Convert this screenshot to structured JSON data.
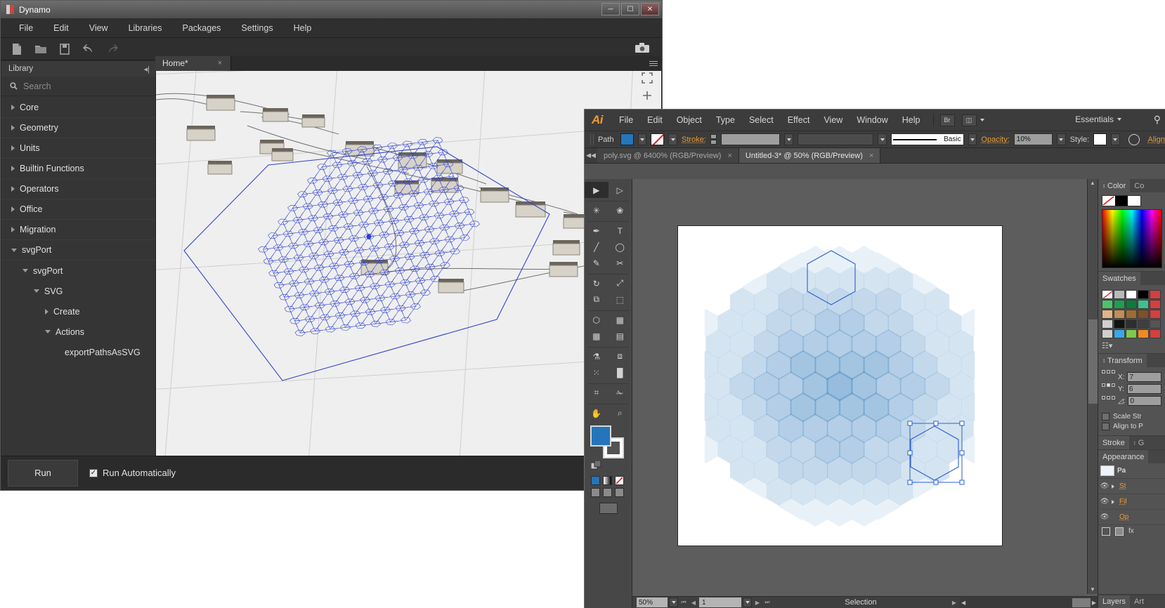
{
  "dynamo": {
    "title": "Dynamo",
    "window_buttons": [
      "minimize",
      "maximize",
      "close"
    ],
    "menus": [
      "File",
      "Edit",
      "View",
      "Libraries",
      "Packages",
      "Settings",
      "Help"
    ],
    "toolbar_icons": [
      "new-file-icon",
      "open-file-icon",
      "save-icon",
      "undo-icon",
      "redo-icon",
      "camera-icon"
    ],
    "library": {
      "header": "Library",
      "collapse_icon": "collapse-panel-icon",
      "search_placeholder": "Search",
      "search_icon": "search-icon",
      "items": [
        {
          "label": "Core",
          "expanded": false,
          "indent": 0
        },
        {
          "label": "Geometry",
          "expanded": false,
          "indent": 0
        },
        {
          "label": "Units",
          "expanded": false,
          "indent": 0
        },
        {
          "label": "Builtin Functions",
          "expanded": false,
          "indent": 0
        },
        {
          "label": "Operators",
          "expanded": false,
          "indent": 0
        },
        {
          "label": "Office",
          "expanded": false,
          "indent": 0
        },
        {
          "label": "Migration",
          "expanded": false,
          "indent": 0
        },
        {
          "label": "svgPort",
          "expanded": true,
          "indent": 0
        },
        {
          "label": "svgPort",
          "expanded": true,
          "indent": 1
        },
        {
          "label": "SVG",
          "expanded": true,
          "indent": 2
        },
        {
          "label": "Create",
          "expanded": false,
          "indent": 3
        },
        {
          "label": "Actions",
          "expanded": true,
          "indent": 3
        },
        {
          "label": "exportPathsAsSVG",
          "expanded": null,
          "indent": 4
        }
      ]
    },
    "tab": {
      "label": "Home*",
      "close": "×"
    },
    "menu_icon": "hamburger-menu-icon",
    "viewport_controls": [
      "fit-to-screen-icon",
      "zoom-in-icon"
    ],
    "footer": {
      "run_label": "Run",
      "auto_label": "Run Automatically",
      "auto_checked": true,
      "check_glyph": "✓"
    }
  },
  "illustrator": {
    "logo": "Ai",
    "menus": [
      "File",
      "Edit",
      "Object",
      "Type",
      "Select",
      "Effect",
      "View",
      "Window",
      "Help"
    ],
    "bridge_button": "Br",
    "arrange_button": "arrange-documents-icon",
    "workspace": "Essentials",
    "search_icon": "search-icon",
    "control_bar": {
      "object_type": "Path",
      "fill_color": "#2575bb",
      "stroke_color": "none",
      "stroke_label": "Stroke:",
      "stroke_weight": "",
      "stroke_profile": "",
      "brush": "Basic",
      "opacity_label": "Opacity:",
      "opacity_value": "10%",
      "style_label": "Style:",
      "align_label": "Align"
    },
    "tabs": [
      {
        "label": "poly.svg @ 6400% (RGB/Preview)",
        "active": false,
        "close": "×"
      },
      {
        "label": "Untitled-3* @ 50% (RGB/Preview)",
        "active": true,
        "close": "×"
      }
    ],
    "tools": [
      "selection-tool-icon",
      "direct-selection-tool-icon",
      "magic-wand-tool-icon",
      "lasso-tool-icon",
      "pen-tool-icon",
      "type-tool-icon",
      "line-segment-tool-icon",
      "ellipse-tool-icon",
      "paintbrush-tool-icon",
      "scissors-tool-icon",
      "rotate-tool-icon",
      "scale-tool-icon",
      "width-tool-icon",
      "free-transform-tool-icon",
      "shape-builder-tool-icon",
      "perspective-grid-tool-icon",
      "mesh-tool-icon",
      "gradient-tool-icon",
      "eyedropper-tool-icon",
      "blend-tool-icon",
      "symbol-sprayer-tool-icon",
      "column-graph-tool-icon",
      "artboard-tool-icon",
      "slice-tool-icon",
      "hand-tool-icon",
      "zoom-tool-icon"
    ],
    "fill_stroke": {
      "fill": "#2575bb",
      "stroke": "none",
      "swap_icon": "swap-fill-stroke-icon",
      "default_icon": "default-fill-stroke-icon"
    },
    "color_modes": [
      "color-mode-icon",
      "gradient-mode-icon",
      "none-mode-icon"
    ],
    "screen_mode_icon": "change-screen-mode-icon",
    "status_bar": {
      "zoom": "50%",
      "page": "1",
      "status_text": "Selection",
      "first_icon": "▏◀",
      "prev_icon": "◀",
      "next_icon": "▶",
      "last_icon": "▶▕"
    },
    "panels": {
      "color": {
        "title": "Color",
        "tab2": "Co"
      },
      "swatches": {
        "title": "Swatches"
      },
      "transform": {
        "title": "Transform",
        "x_label": "X:",
        "x_value": "7",
        "y_label": "Y:",
        "y_value": "6",
        "angle_label": "◿:",
        "angle_value": "0",
        "scale_strokes": "Scale Str",
        "align_pixel": "Align to P"
      },
      "stroke_tab": "Stroke",
      "gradient_tab": "G",
      "appearance": {
        "title": "Appearance",
        "rows": [
          {
            "label": "Pa",
            "type": "path"
          },
          {
            "label": "St",
            "type": "stroke"
          },
          {
            "label": "Fil",
            "type": "fill"
          },
          {
            "label": "Op",
            "type": "opacity"
          }
        ]
      },
      "layers_tab": "Layers",
      "artboards_tab": "Art"
    }
  },
  "artwork": {
    "description": "hexagonal tessellation of overlapping translucent blue triangles",
    "fill_color": "#2575bb",
    "opacity": "10%",
    "selection_color": "#2a5fd0"
  }
}
